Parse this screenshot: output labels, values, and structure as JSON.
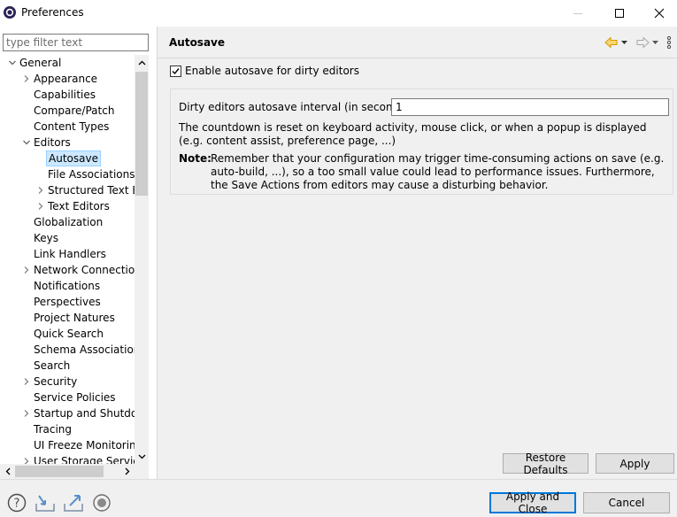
{
  "window": {
    "title": "Preferences"
  },
  "filter": {
    "placeholder": "type filter text"
  },
  "tree": {
    "items": [
      {
        "label": "General",
        "twisty": "expanded",
        "depth": 0
      },
      {
        "label": "Appearance",
        "twisty": "collapsed",
        "depth": 1
      },
      {
        "label": "Capabilities",
        "twisty": "none",
        "depth": 1
      },
      {
        "label": "Compare/Patch",
        "twisty": "none",
        "depth": 1
      },
      {
        "label": "Content Types",
        "twisty": "none",
        "depth": 1
      },
      {
        "label": "Editors",
        "twisty": "expanded",
        "depth": 1
      },
      {
        "label": "Autosave",
        "twisty": "none",
        "depth": 2,
        "selected": true
      },
      {
        "label": "File Associations",
        "twisty": "none",
        "depth": 2
      },
      {
        "label": "Structured Text Ec",
        "twisty": "collapsed",
        "depth": 2
      },
      {
        "label": "Text Editors",
        "twisty": "collapsed",
        "depth": 2
      },
      {
        "label": "Globalization",
        "twisty": "none",
        "depth": 1
      },
      {
        "label": "Keys",
        "twisty": "none",
        "depth": 1
      },
      {
        "label": "Link Handlers",
        "twisty": "none",
        "depth": 1
      },
      {
        "label": "Network Connection",
        "twisty": "collapsed",
        "depth": 1
      },
      {
        "label": "Notifications",
        "twisty": "none",
        "depth": 1
      },
      {
        "label": "Perspectives",
        "twisty": "none",
        "depth": 1
      },
      {
        "label": "Project Natures",
        "twisty": "none",
        "depth": 1
      },
      {
        "label": "Quick Search",
        "twisty": "none",
        "depth": 1
      },
      {
        "label": "Schema Associations",
        "twisty": "none",
        "depth": 1
      },
      {
        "label": "Search",
        "twisty": "none",
        "depth": 1
      },
      {
        "label": "Security",
        "twisty": "collapsed",
        "depth": 1
      },
      {
        "label": "Service Policies",
        "twisty": "none",
        "depth": 1
      },
      {
        "label": "Startup and Shutdow",
        "twisty": "collapsed",
        "depth": 1
      },
      {
        "label": "Tracing",
        "twisty": "none",
        "depth": 1
      },
      {
        "label": "UI Freeze Monitoring",
        "twisty": "none",
        "depth": 1
      },
      {
        "label": "User Storage Service",
        "twisty": "collapsed",
        "depth": 1
      }
    ]
  },
  "page": {
    "title": "Autosave",
    "enable_label": "Enable autosave for dirty editors",
    "enable_checked": true,
    "interval_label": "Dirty editors autosave interval (in seconds):",
    "interval_value": "1",
    "description": "The countdown is reset on keyboard activity, mouse click, or when a popup is displayed (e.g. content assist, preference page, ...)",
    "note_label": "Note:",
    "note_text": "Remember that your configuration may trigger time-consuming actions on save (e.g. auto-build, ...), so a too small value could lead to performance issues. Furthermore, the Save Actions from editors may cause a disturbing behavior."
  },
  "buttons": {
    "restore_defaults": "Restore Defaults",
    "apply": "Apply",
    "apply_and_close": "Apply and Close",
    "cancel": "Cancel"
  },
  "colors": {
    "accent": "#0078d7",
    "selection_bg": "#cce8ff",
    "back_arrow": "#e0a100"
  }
}
